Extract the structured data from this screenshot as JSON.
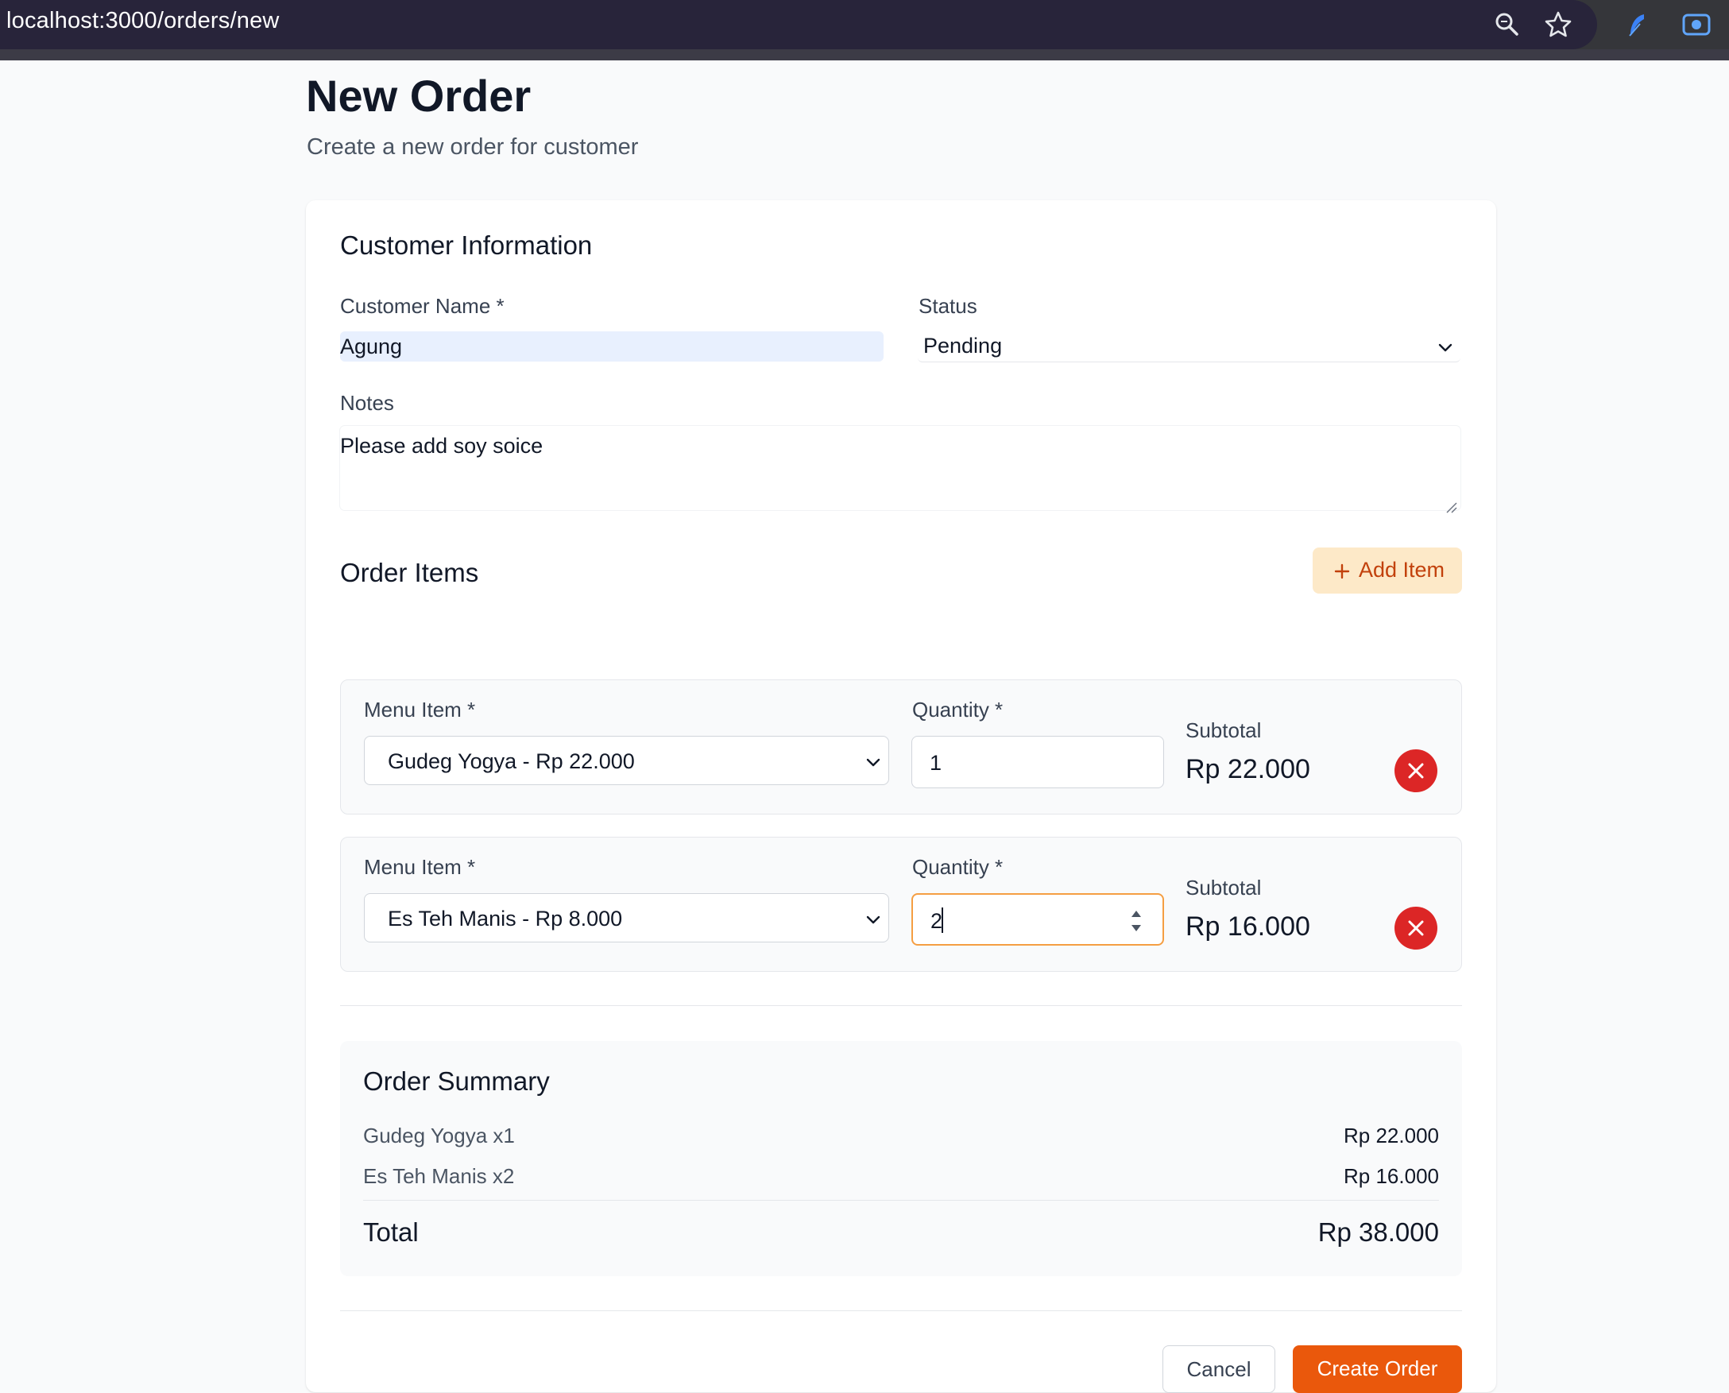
{
  "browser": {
    "url": "localhost:3000/orders/new",
    "icons": [
      "zoom-icon",
      "bookmark-star-icon",
      "extension-feather-icon",
      "screen-record-icon"
    ]
  },
  "page": {
    "title": "New Order",
    "subtitle": "Create a new order for customer"
  },
  "customer": {
    "section_title": "Customer Information",
    "name_label": "Customer Name *",
    "name_value": "Agung",
    "status_label": "Status",
    "status_value": "Pending",
    "notes_label": "Notes",
    "notes_value": "Please add soy soice"
  },
  "order_items": {
    "section_title": "Order Items",
    "add_label": "Add Item",
    "items": [
      {
        "menu_label": "Menu Item *",
        "menu_value": "Gudeg Yogya - Rp 22.000",
        "qty_label": "Quantity *",
        "qty_value": "1",
        "subtotal_label": "Subtotal",
        "subtotal_value": "Rp 22.000"
      },
      {
        "menu_label": "Menu Item *",
        "menu_value": "Es Teh Manis - Rp 8.000",
        "qty_label": "Quantity *",
        "qty_value": "2",
        "subtotal_label": "Subtotal",
        "subtotal_value": "Rp 16.000"
      }
    ]
  },
  "summary": {
    "title": "Order Summary",
    "lines": [
      {
        "name": "Gudeg Yogya x1",
        "amount": "Rp 22.000"
      },
      {
        "name": "Es Teh Manis x2",
        "amount": "Rp 16.000"
      }
    ],
    "total_label": "Total",
    "total_value": "Rp 38.000"
  },
  "actions": {
    "cancel_label": "Cancel",
    "create_label": "Create Order"
  },
  "colors": {
    "accent": "#ea580c",
    "accent_soft": "#fde9c8",
    "danger": "#dc2626",
    "focus": "#f59e42",
    "autofill": "#e8f0fe"
  }
}
